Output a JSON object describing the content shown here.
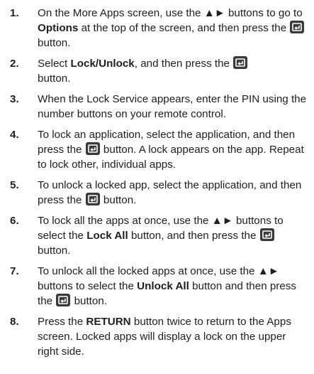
{
  "colors": {
    "text": "#1e1e1e",
    "enter_icon_bg": "#3a3a3a",
    "enter_icon_fg": "#ffffff"
  },
  "steps": [
    {
      "num": "1.",
      "t1": "On the More Apps screen, use the ▲► buttons to go to ",
      "b1": "Options",
      "t2": " at the top of the screen, and then press the ",
      "t3": " button."
    },
    {
      "num": "2.",
      "t1": "Select ",
      "b1": "Lock/Unlock",
      "t2": ", and then press the ",
      "t3": " button."
    },
    {
      "num": "3.",
      "t1": "When the Lock Service appears, enter the PIN using the number buttons on your remote control."
    },
    {
      "num": "4.",
      "t1": "To lock an application, select the application, and then press the ",
      "t2": " button. A lock appears on the app. Repeat to lock other, individual apps."
    },
    {
      "num": "5.",
      "t1": "To unlock a locked app, select the application, and then press the ",
      "t2": " button."
    },
    {
      "num": "6.",
      "t1": "To lock all the apps at once, use the ▲► buttons to select the ",
      "b1": "Lock All",
      "t2": " button, and then press the ",
      "t3": " button."
    },
    {
      "num": "7.",
      "t1": "To unlock all the locked apps at once, use the ▲► buttons to select the ",
      "b1": "Unlock All",
      "t2": " button and then press the ",
      "t3": " button."
    },
    {
      "num": "8.",
      "t1": "Press the ",
      "b1": "RETURN",
      "t2": " button twice to return to the Apps screen. Locked apps will display a lock on the upper right side."
    }
  ]
}
